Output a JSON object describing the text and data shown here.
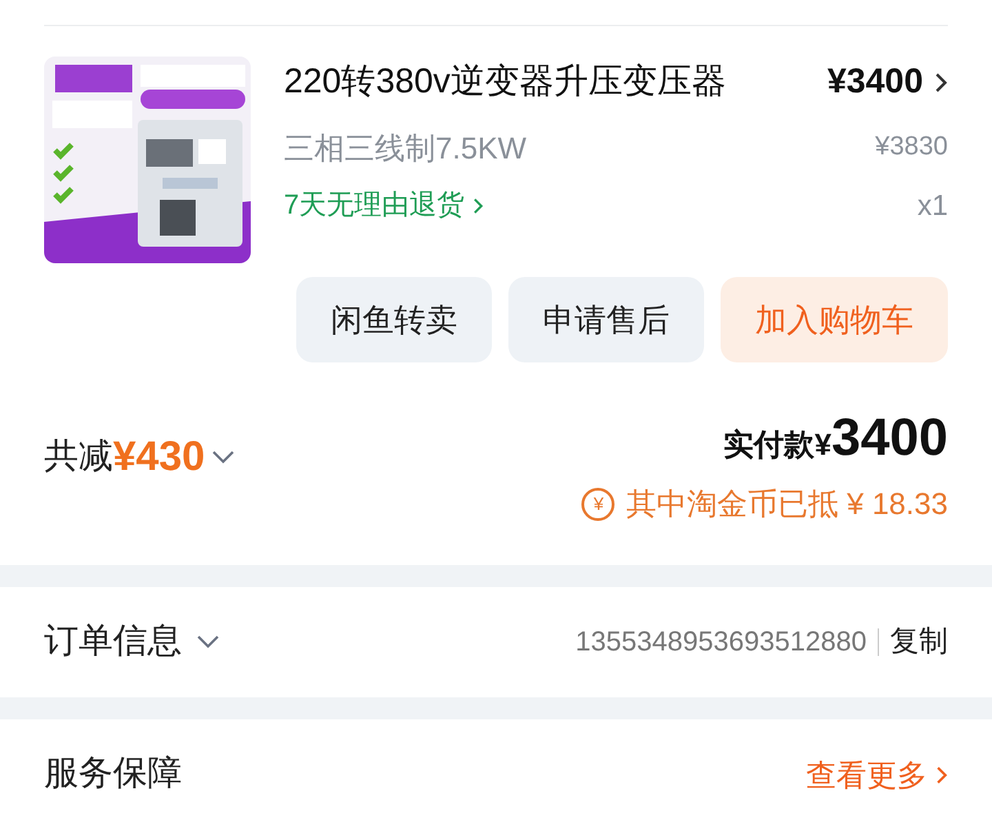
{
  "product": {
    "title": "220转380v逆变器升压变压器",
    "price": "¥3400",
    "spec": "三相三线制7.5KW",
    "original_price": "¥3830",
    "return_policy": "7天无理由退货",
    "quantity": "x1"
  },
  "actions": [
    {
      "label": "闲鱼转卖",
      "kind": "normal"
    },
    {
      "label": "申请售后",
      "kind": "normal"
    },
    {
      "label": "加入购物车",
      "kind": "primary"
    }
  ],
  "summary": {
    "discount_label": "共减",
    "discount": "¥430",
    "paid_label": "实付款¥",
    "paid": "3400",
    "coin_icon": "¥",
    "coin_note": "其中淘金币已抵 ¥ 18.33"
  },
  "order_info": {
    "title": "订单信息",
    "order_number": "1355348953693512880",
    "copy": "复制"
  },
  "service": {
    "title": "服务保障",
    "more": "查看更多"
  }
}
